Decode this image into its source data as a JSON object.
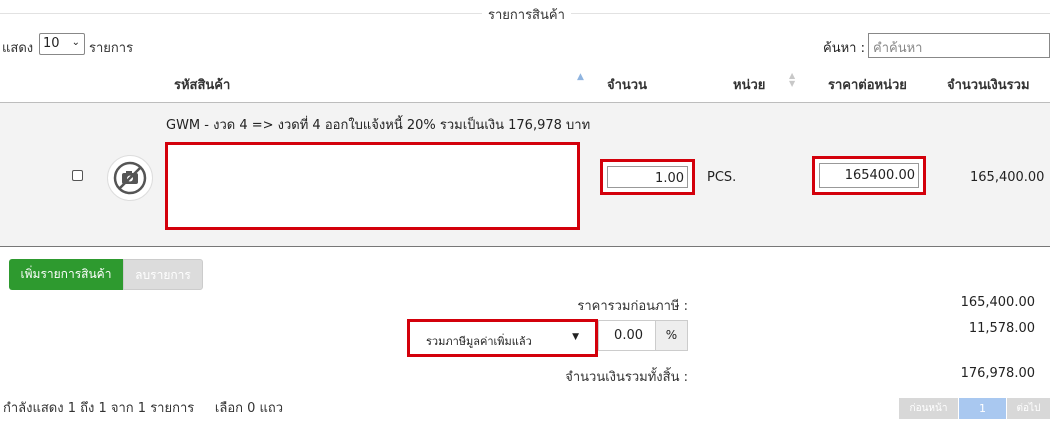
{
  "section_title": "รายการสินค้า",
  "length": {
    "prefix": "แสดง",
    "value": "10",
    "suffix": "รายการ"
  },
  "search": {
    "label": "ค้นหา :",
    "placeholder": "คำค้นหา"
  },
  "columns": {
    "code": "รหัสสินค้า",
    "qty": "จำนวน",
    "unit": "หน่วย",
    "price": "ราคาต่อหน่วย",
    "total": "จำนวนเงินรวม"
  },
  "row": {
    "note": "GWM - งวด 4 => งวดที่ 4 ออกใบแจ้งหนี้ 20% รวมเป็นเงิน 176,978 บาท",
    "description": "",
    "qty": "1.00",
    "unit": "PCS.",
    "price": "165400.00",
    "total": "165,400.00",
    "image_icon": "no-image-icon"
  },
  "buttons": {
    "add": "เพิ่มรายการสินค้า",
    "delete": "ลบรายการ"
  },
  "summary": {
    "subtotal_label": "ราคารวมก่อนภาษี :",
    "subtotal": "165,400.00",
    "vat_option": "รวมภาษีมูลค่าเพิ่มแล้ว",
    "vat_rate": "0.00",
    "vat_unit": "%",
    "vat_amount": "11,578.00",
    "grand_label": "จำนวนเงินรวมทั้งสิ้น :",
    "grand_total": "176,978.00"
  },
  "info": "กำลังแสดง 1 ถึง 1 จาก 1 รายการ     เลือก 0 แถว",
  "pagination": {
    "prev": "ก่อนหน้า",
    "current": "1",
    "next": "ต่อไป"
  },
  "colors": {
    "highlight": "#d3000b",
    "primary_green": "#2e9a2f",
    "active_page": "#a9c8f0"
  }
}
